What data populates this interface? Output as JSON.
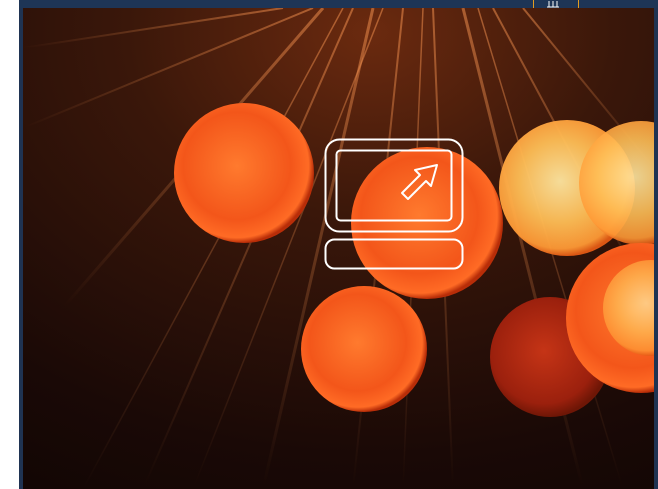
{
  "cover": {
    "background_color": "#1f3352",
    "accent_color": "#e39b1f",
    "photo_theme": "fiber-optic-bokeh",
    "logo": {
      "icon": "monitor-arrow-icon",
      "color": "#ffffff"
    }
  }
}
